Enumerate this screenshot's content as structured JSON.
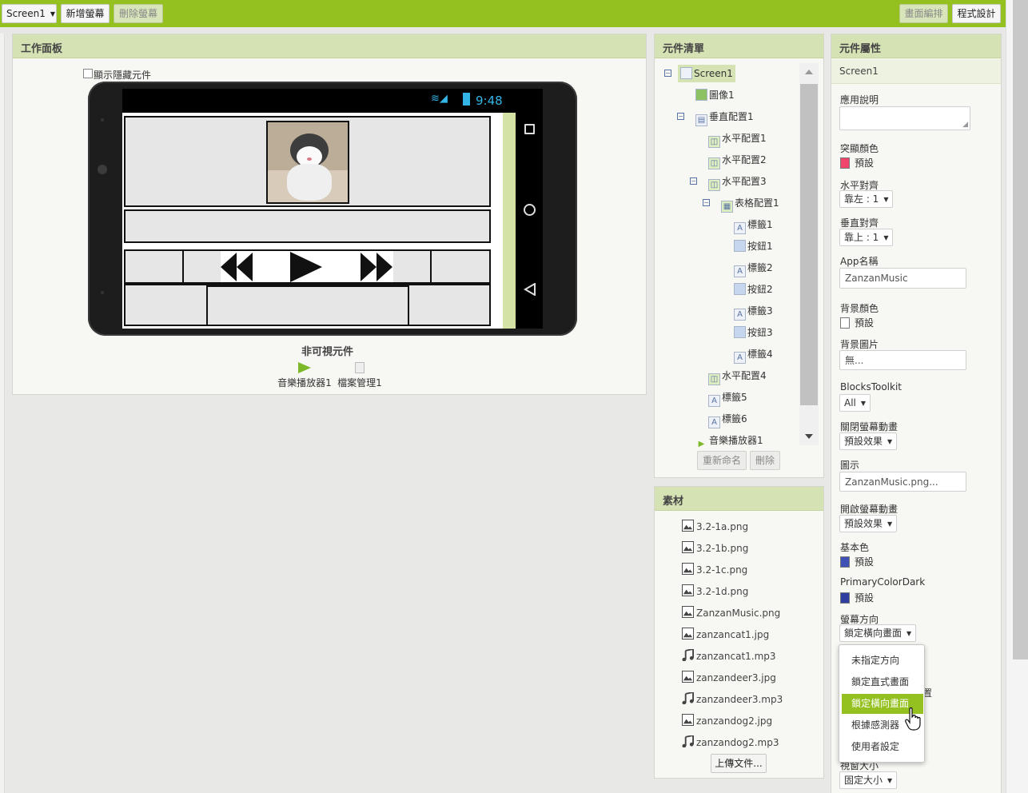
{
  "topbar": {
    "screen_selector": "Screen1",
    "add_screen": "新增螢幕",
    "remove_screen": "刪除螢幕",
    "designer": "畫面編排",
    "blocks": "程式設計"
  },
  "viewer": {
    "title": "工作面板",
    "show_hidden": "顯示隱藏元件",
    "status_time": "9:48",
    "nonvisible_title": "非可視元件",
    "nonvisible": [
      "音樂播放器1",
      "檔案管理1"
    ]
  },
  "components": {
    "title": "元件清單",
    "items": [
      {
        "label": "Screen1",
        "icon": "screen-icon"
      },
      {
        "label": "圖像1",
        "icon": "image-icon"
      },
      {
        "label": "垂直配置1",
        "icon": "vertical-arrangement-icon"
      },
      {
        "label": "水平配置1",
        "icon": "horizontal-arrangement-icon"
      },
      {
        "label": "水平配置2",
        "icon": "horizontal-arrangement-icon"
      },
      {
        "label": "水平配置3",
        "icon": "horizontal-arrangement-icon"
      },
      {
        "label": "表格配置1",
        "icon": "table-arrangement-icon"
      },
      {
        "label": "標籤1",
        "icon": "label-icon"
      },
      {
        "label": "按鈕1",
        "icon": "button-icon"
      },
      {
        "label": "標籤2",
        "icon": "label-icon"
      },
      {
        "label": "按鈕2",
        "icon": "button-icon"
      },
      {
        "label": "標籤3",
        "icon": "label-icon"
      },
      {
        "label": "按鈕3",
        "icon": "button-icon"
      },
      {
        "label": "標籤4",
        "icon": "label-icon"
      },
      {
        "label": "水平配置4",
        "icon": "horizontal-arrangement-icon"
      },
      {
        "label": "標籤5",
        "icon": "label-icon"
      },
      {
        "label": "標籤6",
        "icon": "label-icon"
      },
      {
        "label": "音樂播放器1",
        "icon": "player-icon"
      }
    ],
    "rename": "重新命名",
    "delete": "刪除"
  },
  "media": {
    "title": "素材",
    "items": [
      {
        "label": "3.2-1a.png",
        "icon": "image-file-icon"
      },
      {
        "label": "3.2-1b.png",
        "icon": "image-file-icon"
      },
      {
        "label": "3.2-1c.png",
        "icon": "image-file-icon"
      },
      {
        "label": "3.2-1d.png",
        "icon": "image-file-icon"
      },
      {
        "label": "ZanzanMusic.png",
        "icon": "image-file-icon"
      },
      {
        "label": "zanzancat1.jpg",
        "icon": "image-file-icon"
      },
      {
        "label": "zanzancat1.mp3",
        "icon": "music-file-icon"
      },
      {
        "label": "zanzandeer3.jpg",
        "icon": "image-file-icon"
      },
      {
        "label": "zanzandeer3.mp3",
        "icon": "music-file-icon"
      },
      {
        "label": "zanzandog2.jpg",
        "icon": "image-file-icon"
      },
      {
        "label": "zanzandog2.mp3",
        "icon": "music-file-icon"
      }
    ],
    "upload": "上傳文件..."
  },
  "properties": {
    "title": "元件屬性",
    "component": "Screen1",
    "about_label": "應用說明",
    "accent_label": "突顯顏色",
    "accent_value": "預設",
    "accent_color": "#f0446c",
    "align_h_label": "水平對齊",
    "align_h_value": "靠左 : 1",
    "align_v_label": "垂直對齊",
    "align_v_value": "靠上 : 1",
    "app_name_label": "App名稱",
    "app_name_value": "ZanzanMusic",
    "bg_color_label": "背景顏色",
    "bg_color_value": "預設",
    "bg_color": "#ffffff",
    "bg_image_label": "背景圖片",
    "bg_image_value": "無...",
    "toolkit_label": "BlocksToolkit",
    "toolkit_value": "All",
    "close_anim_label": "關閉螢幕動畫",
    "close_anim_value": "預設效果",
    "icon_label": "圖示",
    "icon_value": "ZanzanMusic.png...",
    "open_anim_label": "開啟螢幕動畫",
    "open_anim_value": "預設效果",
    "primary_label": "基本色",
    "primary_value": "預設",
    "primary_color": "#3f51b5",
    "primary_dark_label": "PrimaryColorDark",
    "primary_dark_value": "預設",
    "primary_dark_color": "#303f9f",
    "orientation_label": "螢幕方向",
    "orientation_value": "鎖定橫向畫面",
    "hidden_partial": "置",
    "sizing_label": "視窗大小",
    "sizing_value": "固定大小"
  },
  "orientation_menu": {
    "options": [
      "未指定方向",
      "鎖定直式畫面",
      "鎖定橫向畫面",
      "根據感測器",
      "使用者設定"
    ],
    "selected": "鎖定橫向畫面"
  },
  "colors": {
    "topbar": "#94c11f",
    "panel_header": "#d5e2b4"
  }
}
